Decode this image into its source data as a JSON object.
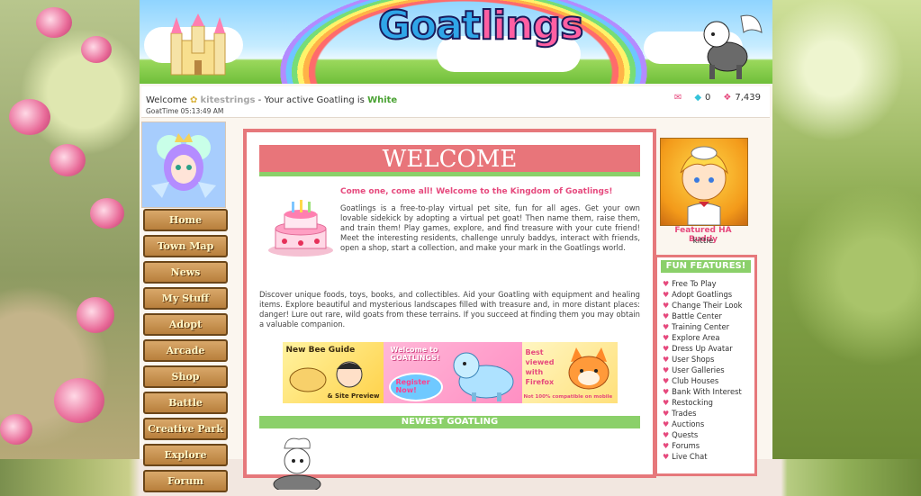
{
  "header": {
    "logo_part1": "Goat",
    "logo_part2": "lings"
  },
  "welcome_bar": {
    "greeting": "Welcome",
    "username": "kitestrings",
    "active_text": " - Your active Goatling is ",
    "active_goatling": "White",
    "time_label": "GoatTime 05:13:49 AM",
    "gems": "0",
    "coins": "7,439"
  },
  "nav": {
    "items": [
      "Home",
      "Town Map",
      "News",
      "My Stuff",
      "Adopt",
      "Arcade",
      "Shop",
      "Battle",
      "Creative Park",
      "Explore",
      "Forum"
    ]
  },
  "main": {
    "heading": "WELCOME",
    "intro_title": "Come one, come all! Welcome to the Kingdom of Goatlings!",
    "intro_body": "Goatlings is a free-to-play virtual pet site, fun for all ages. Get your own lovable sidekick by adopting a virtual pet goat! Then name them, raise them, and train them! Play games, explore, and find treasure with your cute friend! Meet the interesting residents, challenge unruly baddys, interact with friends, open a shop, start a collection, and make your mark in the Goatlings world.",
    "para2": "Discover unique foods, toys, books, and collectibles. Aid your Goatling with equipment and healing items. Explore beautiful and mysterious landscapes filled with treasure and, in more distant places: danger! Lure out rare, wild goats from these terrains. If you succeed at finding them you may obtain a valuable companion.",
    "promo1_line1": "New Bee Guide",
    "promo1_line2": "& Site Preview",
    "promo2_line1": "Welcome to GOATLINGS!",
    "promo2_line2": "Register Now!",
    "promo3_line1": "Best viewed with Firefox",
    "promo3_line2": "Not 100% compatible on mobile",
    "newest_heading": "NEWEST GOATLING"
  },
  "sidebar": {
    "featured_label": "Featured HA Buddy",
    "featured_name": "kittie",
    "fun_heading": "FUN FEATURES!",
    "features": [
      "Free To Play",
      "Adopt Goatlings",
      "Change Their Look",
      "Battle Center",
      "Training Center",
      "Explore Area",
      "Dress Up Avatar",
      "User Shops",
      "User Galleries",
      "Club Houses",
      "Bank With Interest",
      "Restocking",
      "Trades",
      "Auctions",
      "Quests",
      "Forums",
      "Live Chat"
    ]
  }
}
